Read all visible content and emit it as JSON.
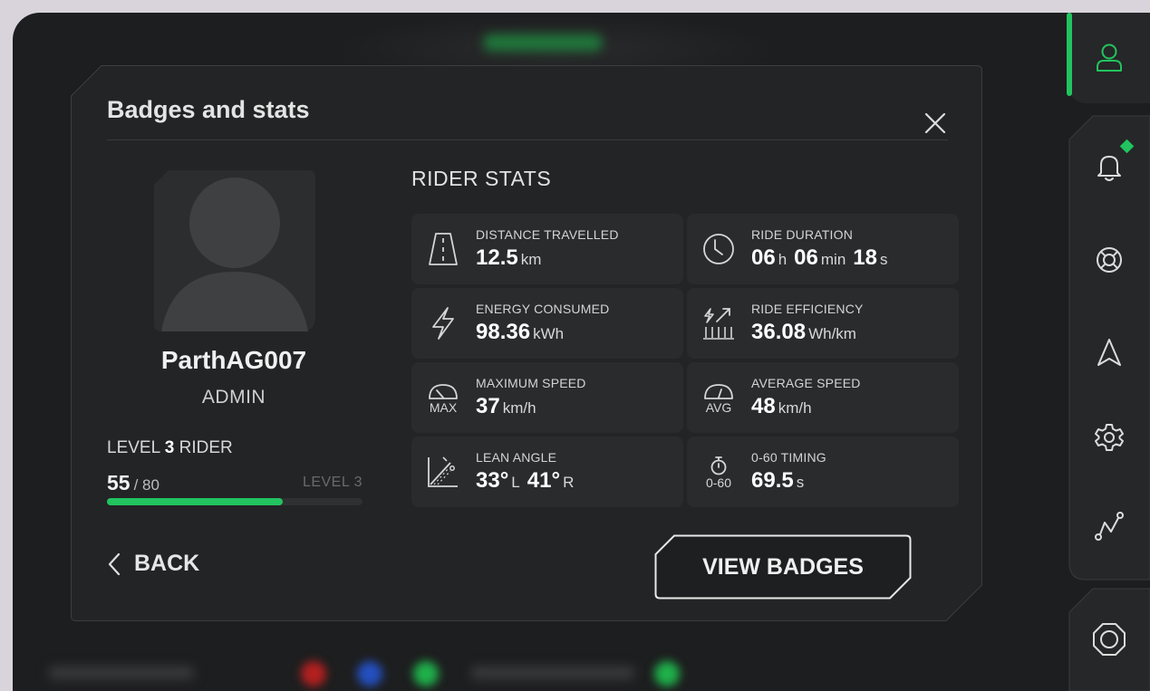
{
  "modal": {
    "title": "Badges and stats",
    "close_icon": "close-icon"
  },
  "profile": {
    "username": "ParthAG007",
    "role": "ADMIN",
    "level_prefix": "LEVEL",
    "level_number": "3",
    "level_suffix": "RIDER",
    "xp_current": "55",
    "xp_total": "/ 80",
    "next_level_label": "LEVEL 3",
    "xp_progress_fraction": 0.6875
  },
  "stats": {
    "heading": "RIDER STATS",
    "cards": [
      {
        "icon": "road-icon",
        "label": "DISTANCE TRAVELLED",
        "parts": [
          {
            "num": "12.5",
            "unit": "km"
          }
        ]
      },
      {
        "icon": "clock-icon",
        "label": "RIDE DURATION",
        "parts": [
          {
            "num": "06",
            "unit": "h"
          },
          {
            "num": "06",
            "unit": "min"
          },
          {
            "num": "18",
            "unit": "s"
          }
        ]
      },
      {
        "icon": "lightning-icon",
        "label": "ENERGY CONSUMED",
        "parts": [
          {
            "num": "98.36",
            "unit": "kWh"
          }
        ]
      },
      {
        "icon": "efficiency-icon",
        "label": "RIDE EFFICIENCY",
        "parts": [
          {
            "num": "36.08",
            "unit": "Wh/km"
          }
        ]
      },
      {
        "icon": "speedometer-max-icon",
        "icon_text": "MAX",
        "label": "MAXIMUM SPEED",
        "parts": [
          {
            "num": "37",
            "unit": "km/h"
          }
        ]
      },
      {
        "icon": "speedometer-avg-icon",
        "icon_text": "AVG",
        "label": "AVERAGE SPEED",
        "parts": [
          {
            "num": "48",
            "unit": "km/h"
          }
        ]
      },
      {
        "icon": "lean-angle-icon",
        "label": "LEAN ANGLE",
        "parts": [
          {
            "num": "33°",
            "unit": "L"
          },
          {
            "num": "41°",
            "unit": "R"
          }
        ]
      },
      {
        "icon": "stopwatch-icon",
        "icon_text": "0-60",
        "label": "0-60 TIMING",
        "parts": [
          {
            "num": "69.5",
            "unit": "s"
          }
        ]
      }
    ]
  },
  "footer": {
    "back_label": "BACK",
    "view_badges_label": "VIEW BADGES"
  },
  "rail": {
    "items": [
      "profile-icon",
      "bell-icon",
      "lifebuoy-icon",
      "navigation-icon",
      "gear-icon",
      "route-icon",
      "power-icon"
    ],
    "active": "profile-icon"
  },
  "colors": {
    "accent": "#21c45f",
    "panel": "#232425",
    "card": "#2a2b2c",
    "background": "#1d1e1f"
  }
}
